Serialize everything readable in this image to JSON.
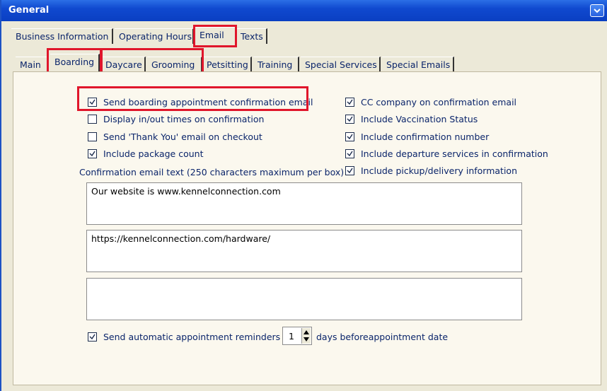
{
  "window": {
    "title": "General"
  },
  "top_tabs": [
    {
      "label": "Business Information"
    },
    {
      "label": "Operating Hours"
    },
    {
      "label": "Email"
    },
    {
      "label": "Texts"
    }
  ],
  "sub_tabs": [
    {
      "label": "Main"
    },
    {
      "label": "Boarding"
    },
    {
      "label": "Daycare"
    },
    {
      "label": "Grooming"
    },
    {
      "label": "Petsitting"
    },
    {
      "label": "Training"
    },
    {
      "label": "Special Services"
    },
    {
      "label": "Special Emails"
    }
  ],
  "left_options": [
    {
      "label": "Send boarding appointment confirmation email",
      "checked": true
    },
    {
      "label": "Display in/out times on confirmation",
      "checked": false
    },
    {
      "label": "Send 'Thank You' email on checkout",
      "checked": false
    },
    {
      "label": "Include package count",
      "checked": true
    }
  ],
  "right_options": [
    {
      "label": "CC company on confirmation email",
      "checked": true
    },
    {
      "label": "Include Vaccination Status",
      "checked": true
    },
    {
      "label": "Include confirmation number",
      "checked": true
    },
    {
      "label": "Include departure services in confirmation",
      "checked": true
    },
    {
      "label": "Include pickup/delivery information",
      "checked": true
    }
  ],
  "confirmation_text_label": "Confirmation email text (250 characters maximum per box)",
  "text_boxes": [
    {
      "value": "Our website is www.kennelconnection.com"
    },
    {
      "value": "https://kennelconnection.com/hardware/"
    },
    {
      "value": ""
    }
  ],
  "reminders": {
    "label": "Send automatic appointment reminders",
    "checked": true,
    "days_value": "1",
    "suffix": "days beforeappointment date"
  },
  "colors": {
    "highlight": "#e0162b",
    "titlebar": "#1049cf",
    "label_text": "#0a246a"
  }
}
